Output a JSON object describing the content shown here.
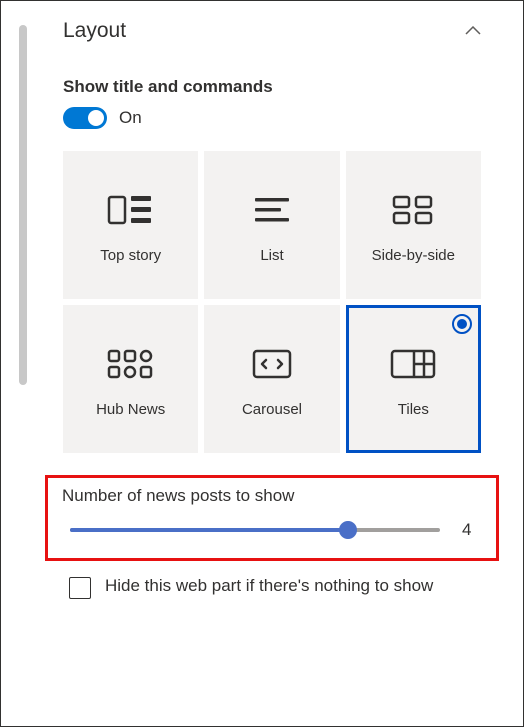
{
  "section": {
    "title": "Layout"
  },
  "toggle": {
    "label": "Show title and commands",
    "state": "On"
  },
  "layouts": [
    {
      "name": "Top story"
    },
    {
      "name": "List"
    },
    {
      "name": "Side-by-side"
    },
    {
      "name": "Hub News"
    },
    {
      "name": "Carousel"
    },
    {
      "name": "Tiles"
    }
  ],
  "slider": {
    "label": "Number of news posts to show",
    "value": "4"
  },
  "checkbox": {
    "label": "Hide this web part if there's nothing to show"
  }
}
